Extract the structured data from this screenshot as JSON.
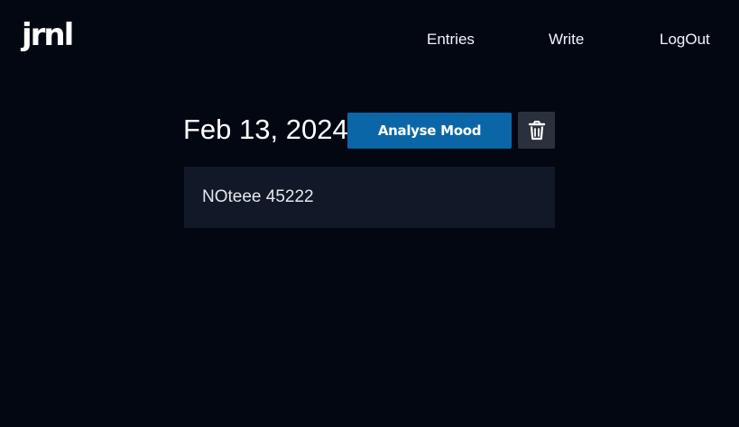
{
  "app": {
    "logo": "jrnl"
  },
  "nav": {
    "entries_label": "Entries",
    "write_label": "Write",
    "logout_label": "LogOut"
  },
  "entry": {
    "date": "Feb 13, 2024",
    "analyse_label": "Analyse Mood",
    "body": "NOteee 45222"
  },
  "icons": {
    "delete": "trash-icon"
  },
  "colors": {
    "background": "#030712",
    "card": "#111827",
    "primary_button": "#0b66a8",
    "secondary_button": "#2a313d",
    "text": "#ffffff"
  }
}
